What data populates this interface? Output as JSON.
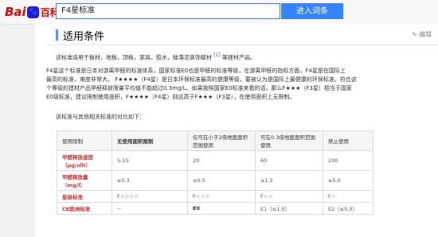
{
  "header": {
    "logo_bai": "Bai",
    "logo_paw": "du",
    "logo_cn": "百科",
    "search_value": "F4星标准",
    "search_button": "进入词条"
  },
  "section": {
    "title": "适用条件",
    "edit_label": "编辑"
  },
  "paragraphs": {
    "p1_text": "该标准适用于板材，地板，顶板，家具，胶水，硅藻泥装饰壁材",
    "p1_cite": "[1]",
    "p1_tail": "等建材产品。",
    "p2_line1": "F4星这个标准是日本对游离甲醛的标准体系，国家标准E0也是甲醛的标准等级，在游离甲醛的指标方面，F4星是在国际上",
    "p2_line2": "最高的标准，难度非常大。 F★★★★（F4星）是日本环保标准最高的健康等级，要被认为是国际上最健康的环保标准。符合这",
    "p2_line3": "个等级的建材产品甲醛释放限量平均值不能超过0.3mg/L。如果按照国家E0标准来看的话，那么F★★★（F3星）相当于国家",
    "p2_line4": "E0级标准，建议限制使用面积，F★★★★（F4星）则远高于F★★★（F3星），在使用面积上无限制。",
    "p3": "该标准与其他相关标准的对比如下："
  },
  "table": {
    "header": [
      "使用限制",
      "无使用面积限制",
      "仅可在小于2倍地面面积范围使用",
      "可在0.3倍地面面积范围使用",
      "禁止使用"
    ],
    "rows": [
      {
        "label": "甲醛释放速度（μg/㎡h）",
        "cells": [
          "5-15",
          "20",
          "60",
          "200"
        ]
      },
      {
        "label": "甲醛释放量（mg/l）",
        "cells": [
          "≤0.3",
          "≤0.5",
          "≤1.5",
          "≤5.0"
        ]
      },
      {
        "label": "星级标准",
        "cells": [
          "F☆☆☆☆",
          "F☆☆☆",
          "F☆☆",
          "F☆"
        ]
      },
      {
        "label": "CE欧洲标准",
        "cells": [
          "--",
          "E0",
          "E1（≤1.5）",
          "E2（≤5.0）"
        ]
      }
    ]
  },
  "colors": {
    "accent": "#3385ff",
    "brand_red": "#e10602",
    "section_bar": "#4f9cee"
  }
}
